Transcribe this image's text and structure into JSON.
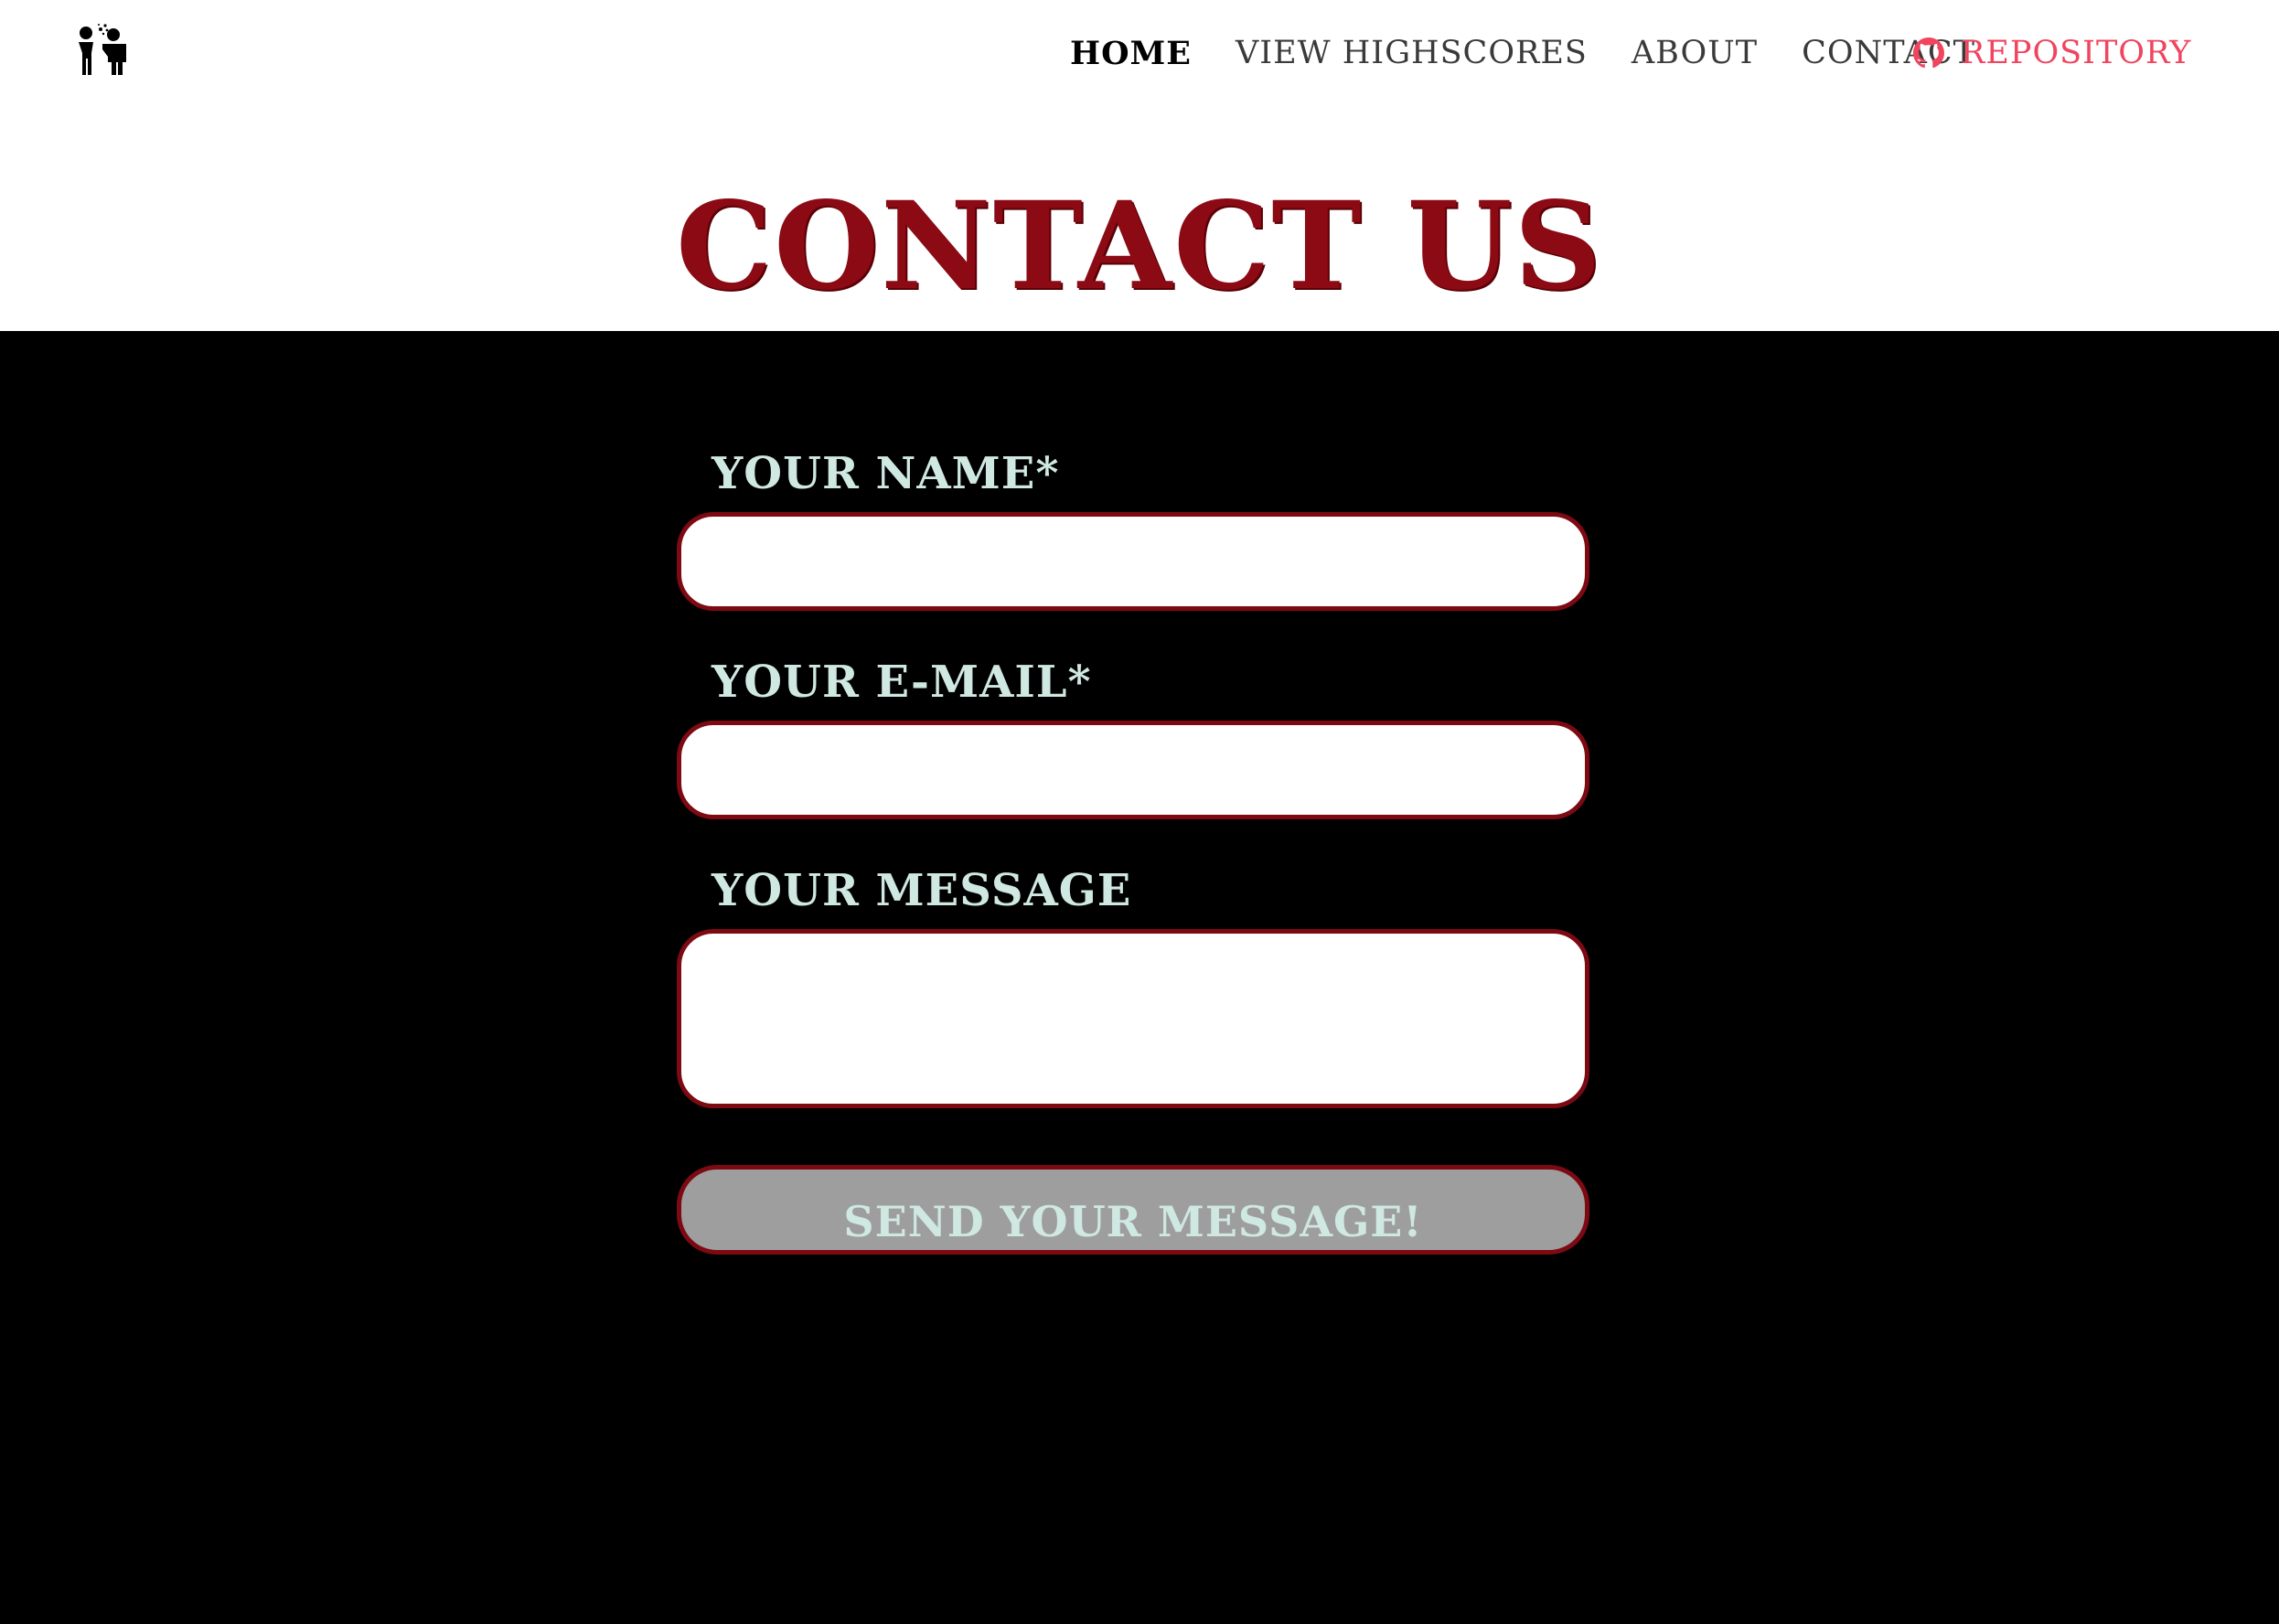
{
  "nav": {
    "logo_icon": "zombie-pair-icon",
    "links": [
      {
        "label": "HOME",
        "active": true
      },
      {
        "label": "VIEW HIGHSCORES",
        "active": false
      },
      {
        "label": "ABOUT",
        "active": false
      },
      {
        "label": "CONTACT",
        "active": false
      }
    ],
    "repository": {
      "label": "REPOSITORY",
      "icon": "github-icon",
      "color": "#f0445f"
    }
  },
  "header": {
    "title": "CONTACT US",
    "color": "#8b0a14"
  },
  "form": {
    "name_label": "YOUR NAME*",
    "name_value": "",
    "email_label": "YOUR E-MAIL*",
    "email_value": "",
    "message_label": "YOUR MESSAGE",
    "message_value": "",
    "submit_label": "SEND YOUR MESSAGE!",
    "border_color": "#7d0a12",
    "label_color": "#cfe8e2"
  }
}
